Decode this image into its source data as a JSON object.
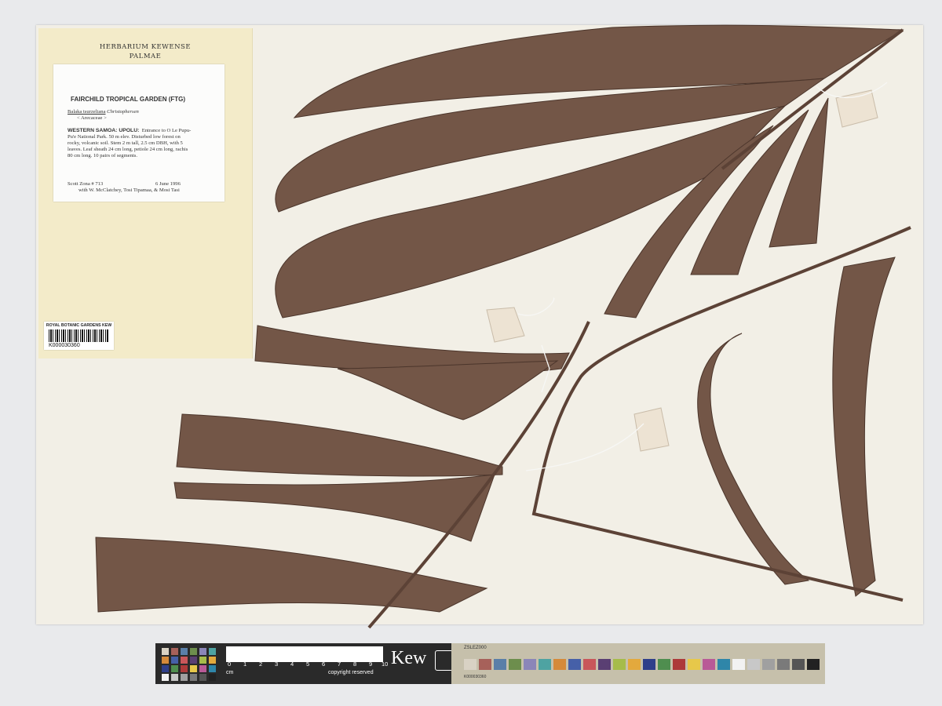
{
  "folder": {
    "header_line1": "HERBARIUM KEWENSE",
    "header_line2": "PALMAE"
  },
  "label": {
    "title": "FAIRCHILD TROPICAL GARDEN (FTG)",
    "taxon_name": "Balaka tsurzeliana",
    "taxon_author": "Christophersen",
    "family": "< Arecaceae >",
    "locality_heading": "WESTERN SAMOA: UPOLU:",
    "locality_lines": [
      "Entrance to O Le Pupu-",
      "Pu'e National Park.  50 m elev.  Disturbed low forest on",
      "rocky, volcanic soil.  Stem 2 m tall, 2.5 cm DBH, with 5",
      "leaves.  Leaf sheath 24 cm long, petiole 24 cm long, rachis",
      "80 cm long.  10 pairs of segments."
    ],
    "collector": "Scott Zona # 713",
    "date": "6 June 1996",
    "with": "with W. McClatchey, Tosi Tipamaa, & Mosi Tasi"
  },
  "barcode": {
    "institution": "ROYAL BOTANIC GARDENS KEW",
    "code": "K000030360"
  },
  "scale_bar": {
    "numbers": [
      "0",
      "1",
      "2",
      "3",
      "4",
      "5",
      "6",
      "7",
      "8",
      "9",
      "10"
    ],
    "unit": "cm",
    "copyright": "copyright reserved",
    "brand": "Kew",
    "card_top_text": "ZSLEZ000",
    "card_bottom_text": "K000030360",
    "swatch_colors": [
      "#d9d2c4",
      "#a7615a",
      "#5a7fa8",
      "#6d8e4d",
      "#8b86b8",
      "#4ea3a2",
      "#d58a3a",
      "#4660a8",
      "#c9575a",
      "#5a3f73",
      "#a6bc4a",
      "#e3a93d",
      "#2f3f8a",
      "#4f8e4f",
      "#ad3a3a",
      "#e7c84a",
      "#b95a97",
      "#2f86a9",
      "#f2f2f2",
      "#c8c8c8",
      "#a0a0a0",
      "#7a7a7a",
      "#555555",
      "#222222"
    ]
  }
}
